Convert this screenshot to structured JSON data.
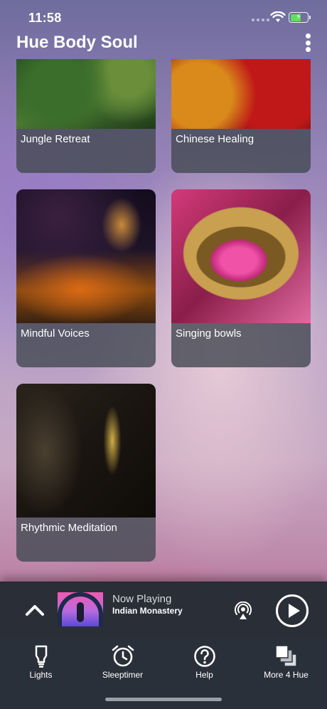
{
  "status_bar": {
    "time": "11:58"
  },
  "header": {
    "title": "Hue Body Soul"
  },
  "categories": [
    {
      "label": "Jungle Retreat"
    },
    {
      "label": "Chinese Healing"
    },
    {
      "label": "Mindful Voices"
    },
    {
      "label": "Singing bowls"
    },
    {
      "label": "Rhythmic Meditation"
    }
  ],
  "player": {
    "now_playing_label": "Now Playing",
    "track": "Indian Monastery"
  },
  "tabs": [
    {
      "label": "Lights",
      "icon": "lightbulb-icon"
    },
    {
      "label": "Sleeptimer",
      "icon": "alarm-clock-icon"
    },
    {
      "label": "Help",
      "icon": "help-circle-icon"
    },
    {
      "label": "More 4 Hue",
      "icon": "stacked-squares-icon"
    }
  ],
  "colors": {
    "player_background": "#2a2f37",
    "tabbar_background": "#2a3039",
    "battery_fill": "#5dde5d"
  }
}
